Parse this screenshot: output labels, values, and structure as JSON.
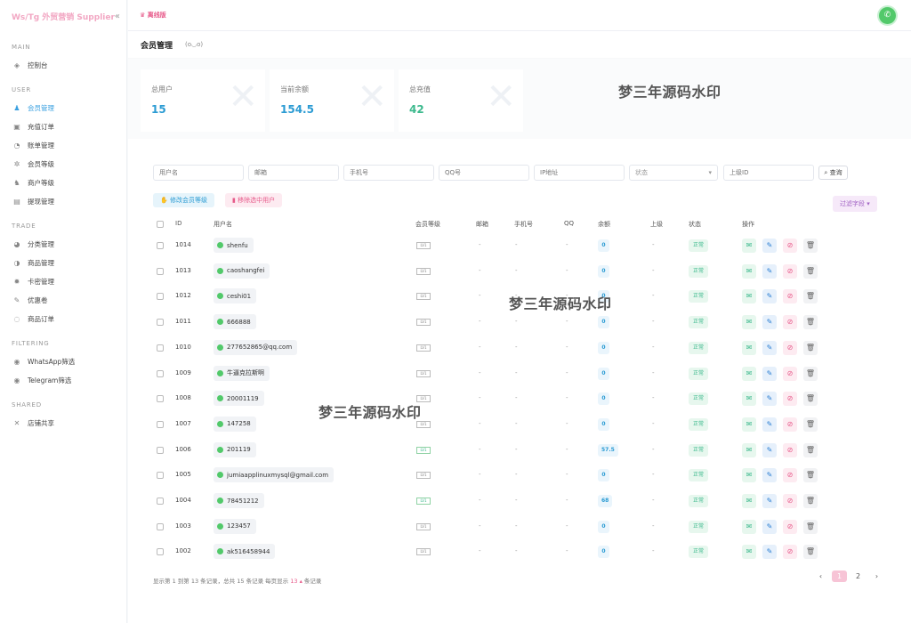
{
  "sidebar": {
    "brand": "Ws/Tg 外贸营销 Supplier",
    "collapse_icon": "«",
    "sections": [
      {
        "title": "MAIN",
        "items": [
          {
            "label": "控制台",
            "icon": "dashboard-icon",
            "glyph": "◈"
          }
        ]
      },
      {
        "title": "USER",
        "items": [
          {
            "label": "会员管理",
            "icon": "user-icon",
            "glyph": "♟",
            "active": true
          },
          {
            "label": "充值订单",
            "icon": "recharge-icon",
            "glyph": "▣"
          },
          {
            "label": "账单管理",
            "icon": "bill-icon",
            "glyph": "◔"
          },
          {
            "label": "会员等级",
            "icon": "level-icon",
            "glyph": "✲"
          },
          {
            "label": "商户等级",
            "icon": "merchant-icon",
            "glyph": "♞"
          },
          {
            "label": "提现管理",
            "icon": "withdraw-icon",
            "glyph": "▤"
          }
        ]
      },
      {
        "title": "TRADE",
        "items": [
          {
            "label": "分类管理",
            "icon": "category-icon",
            "glyph": "◕"
          },
          {
            "label": "商品管理",
            "icon": "product-icon",
            "glyph": "◑"
          },
          {
            "label": "卡密管理",
            "icon": "card-icon",
            "glyph": "✹"
          },
          {
            "label": "优惠卷",
            "icon": "coupon-icon",
            "glyph": "✎"
          },
          {
            "label": "商品订单",
            "icon": "order-icon",
            "glyph": "◌"
          }
        ]
      },
      {
        "title": "FILTERING",
        "items": [
          {
            "label": "WhatsApp筛选",
            "icon": "whatsapp-filter-icon",
            "glyph": "◉"
          },
          {
            "label": "Telegram筛选",
            "icon": "telegram-filter-icon",
            "glyph": "◉"
          }
        ]
      },
      {
        "title": "SHARED",
        "items": [
          {
            "label": "店铺共享",
            "icon": "share-icon",
            "glyph": "✕"
          }
        ]
      }
    ]
  },
  "topbar": {
    "offline_label": "离线版",
    "offline_glyph": "♛",
    "avatar_icon": "whatsapp-avatar-icon"
  },
  "page": {
    "title": "会员管理",
    "subtitle": "(o◡o)"
  },
  "stats": [
    {
      "label": "总用户",
      "value": "15"
    },
    {
      "label": "当前余额",
      "value": "154.5"
    },
    {
      "label": "总充值",
      "value": "42"
    }
  ],
  "watermark": "梦三年源码水印",
  "filters": {
    "username": "用户名",
    "email": "邮箱",
    "phone": "手机号",
    "qq": "QQ号",
    "ip": "IP地址",
    "status": "状态",
    "parent_id": "上级ID",
    "query_button": "查询"
  },
  "actions": {
    "edit_level": "修改会员等级",
    "remove_selected": "移除选中用户",
    "filter_fields": "过滤字段"
  },
  "table": {
    "headers": {
      "id": "ID",
      "username": "用户名",
      "level": "会员等级",
      "email": "邮箱",
      "phone": "手机号",
      "qq": "QQ",
      "balance": "余额",
      "parent": "上级",
      "status": "状态",
      "ops": "操作"
    },
    "rows": [
      {
        "id": "1014",
        "username": "shenfu",
        "balance": "0",
        "vip": false
      },
      {
        "id": "1013",
        "username": "caoshangfei",
        "balance": "0",
        "vip": false
      },
      {
        "id": "1012",
        "username": "ceshi01",
        "balance": "0",
        "vip": false
      },
      {
        "id": "1011",
        "username": "666888",
        "balance": "0",
        "vip": false
      },
      {
        "id": "1010",
        "username": "277652865@qq.com",
        "balance": "0",
        "vip": false
      },
      {
        "id": "1009",
        "username": "牛逼克拉斯啊",
        "balance": "0",
        "vip": false
      },
      {
        "id": "1008",
        "username": "20001119",
        "balance": "0",
        "vip": false
      },
      {
        "id": "1007",
        "username": "147258",
        "balance": "0",
        "vip": false
      },
      {
        "id": "1006",
        "username": "201119",
        "balance": "57.5",
        "vip": true
      },
      {
        "id": "1005",
        "username": "jumiaapplinuxmysql@gmail.com",
        "balance": "0",
        "vip": false
      },
      {
        "id": "1004",
        "username": "78451212",
        "balance": "68",
        "vip": true
      },
      {
        "id": "1003",
        "username": "123457",
        "balance": "0",
        "vip": false
      },
      {
        "id": "1002",
        "username": "ak516458944",
        "balance": "0",
        "vip": false
      }
    ],
    "empty_value": "-",
    "status_text": "正常",
    "level_text": "LV1",
    "op_icons": [
      "message-icon",
      "user-edit-icon",
      "ban-icon",
      "delete-icon"
    ],
    "op_glyphs": [
      "✉",
      "✎",
      "⊘",
      "🗑"
    ]
  },
  "footer": {
    "info_prefix": "显示第 1 到第 13 条记录，总共 15 条记录  每页显示",
    "page_size": "13",
    "info_suffix": "条记录"
  },
  "pagination": {
    "prev": "‹",
    "pages": [
      "1",
      "2"
    ],
    "current": "1",
    "next": "›"
  }
}
